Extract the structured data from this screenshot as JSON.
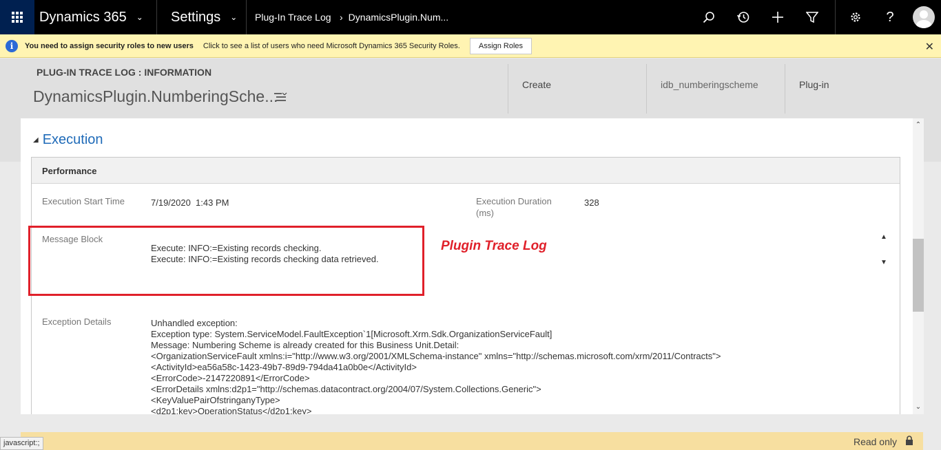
{
  "nav": {
    "app_name": "Dynamics 365",
    "area": "Settings",
    "breadcrumb1": "Plug-In Trace Log",
    "breadcrumb2": "DynamicsPlugin.Num..."
  },
  "notification": {
    "bold_text": "You need to assign security roles to new users",
    "text": "Click to see a list of users who need Microsoft Dynamics 365 Security Roles.",
    "button": "Assign Roles"
  },
  "header": {
    "entity_label": "PLUG-IN TRACE LOG : INFORMATION",
    "record_title": "DynamicsPlugin.NumberingSche...",
    "fields": [
      "Create",
      "idb_numberingscheme",
      "Plug-in"
    ]
  },
  "section": {
    "title": "Execution",
    "subsection": "Performance",
    "start_time_label": "Execution Start Time",
    "start_time_value": "7/19/2020  1:43 PM",
    "duration_label": "Execution Duration",
    "duration_unit": "(ms)",
    "duration_value": "328",
    "message_label": "Message Block",
    "message_lines": [
      "Execute: INFO:=Existing records checking.",
      "Execute: INFO:=Existing records checking data retrieved."
    ],
    "exception_label": "Exception Details",
    "exception_lines": [
      "Unhandled exception:",
      "Exception type: System.ServiceModel.FaultException`1[Microsoft.Xrm.Sdk.OrganizationServiceFault]",
      "Message: Numbering Scheme is already created for this Business Unit.Detail:",
      "<OrganizationServiceFault xmlns:i=\"http://www.w3.org/2001/XMLSchema-instance\" xmlns=\"http://schemas.microsoft.com/xrm/2011/Contracts\">",
      "<ActivityId>ea56a58c-1423-49b7-89d9-794da41a0b0e</ActivityId>",
      "<ErrorCode>-2147220891</ErrorCode>",
      "<ErrorDetails xmlns:d2p1=\"http://schemas.datacontract.org/2004/07/System.Collections.Generic\">",
      "<KeyValuePairOfstringanyType>",
      "<d2p1:key>OperationStatus</d2p1:key>"
    ]
  },
  "annotation": "Plugin Trace Log",
  "footer": {
    "read_only": "Read only",
    "status_url": "javascript:;"
  },
  "colors": {
    "nav_bg": "#000000",
    "waffle_bg": "#002050",
    "notification_bg": "#fff4b2",
    "accent_blue": "#1e6ab8",
    "annotation_red": "#e0202a",
    "footer_bg": "#f7dfa0"
  },
  "icons": [
    "waffle-icon",
    "search-icon",
    "history-icon",
    "plus-icon",
    "filter-icon",
    "gear-icon",
    "help-icon",
    "avatar",
    "info-icon",
    "close-icon",
    "menu-icon",
    "lock-icon"
  ]
}
